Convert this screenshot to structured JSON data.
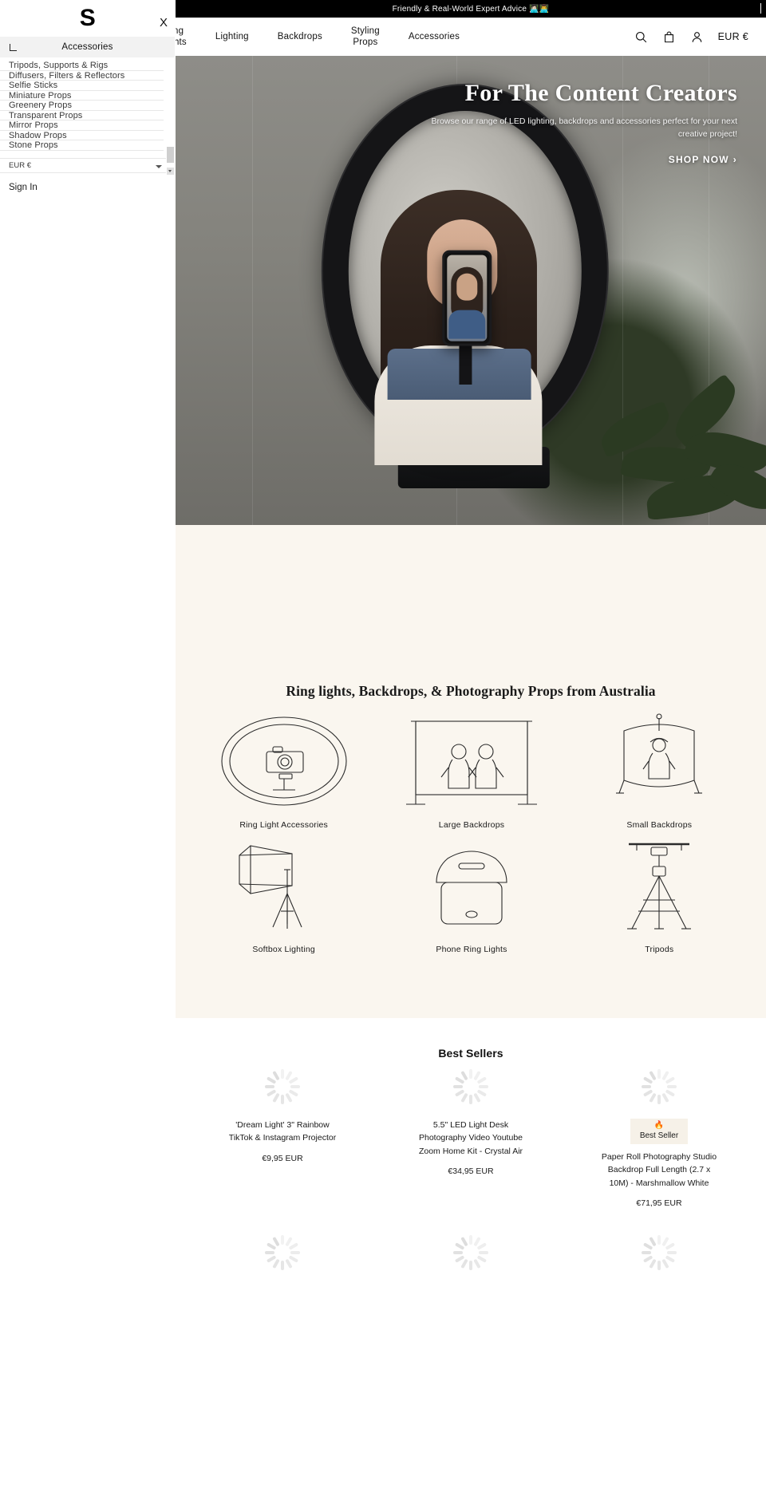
{
  "announcement": {
    "text": "Friendly & Real-World Expert Advice 👩🏻‍💻👨‍💻"
  },
  "header": {
    "logo": "S",
    "nav": [
      {
        "label": "Ring\nLights"
      },
      {
        "label": "Lighting"
      },
      {
        "label": "Backdrops"
      },
      {
        "label": "Styling\nProps"
      },
      {
        "label": "Accessories"
      }
    ],
    "icons": {
      "search": "search-icon",
      "bag": "bag-icon",
      "account": "account-icon"
    },
    "currency": "EUR €"
  },
  "drawer": {
    "close_label": "X",
    "back_label": "back-arrow",
    "title": "Accessories",
    "items": [
      {
        "label": "Tripods, Supports & Rigs"
      },
      {
        "label": "Diffusers, Filters & Reflectors"
      },
      {
        "label": "Selfie Sticks"
      },
      {
        "label": "Miniature Props"
      },
      {
        "label": "Greenery Props"
      },
      {
        "label": "Transparent Props"
      },
      {
        "label": "Mirror Props"
      },
      {
        "label": "Shadow Props"
      },
      {
        "label": "Stone Props"
      }
    ],
    "currency": "EUR €",
    "signin": "Sign In"
  },
  "hero": {
    "title": "For The Content Creators",
    "subtitle": "Browse our range of LED lighting, backdrops and accessories perfect for your next creative project!",
    "cta": "SHOP NOW",
    "cta_chevron": "›"
  },
  "categories": {
    "heading": "Ring lights, Backdrops, & Photography Props from Australia",
    "items": [
      {
        "label": "Ring Light Accessories",
        "art": "ring-light-accessories-icon"
      },
      {
        "label": "Large Backdrops",
        "art": "large-backdrops-icon"
      },
      {
        "label": "Small Backdrops",
        "art": "small-backdrops-icon"
      },
      {
        "label": "Softbox Lighting",
        "art": "softbox-lighting-icon"
      },
      {
        "label": "Phone Ring Lights",
        "art": "phone-ring-lights-icon"
      },
      {
        "label": "Tripods",
        "art": "tripods-icon"
      }
    ]
  },
  "best_sellers": {
    "title": "Best Sellers",
    "products": [
      {
        "name": "'Dream Light' 3\" Rainbow TikTok & Instagram Projector",
        "price": "€9,95 EUR",
        "badge": null
      },
      {
        "name": "5.5\" LED Light Desk Photography Video Youtube Zoom Home Kit - Crystal Air",
        "price": "€34,95 EUR",
        "badge": null
      },
      {
        "name": "Paper Roll Photography Studio Backdrop Full Length (2.7 x 10M) - Marshmallow White",
        "price": "€71,95 EUR",
        "badge": {
          "icon": "🔥",
          "label": "Best Seller"
        }
      },
      {
        "name": "",
        "price": "",
        "badge": null
      },
      {
        "name": "",
        "price": "",
        "badge": null
      },
      {
        "name": "",
        "price": "",
        "badge": null
      }
    ]
  }
}
